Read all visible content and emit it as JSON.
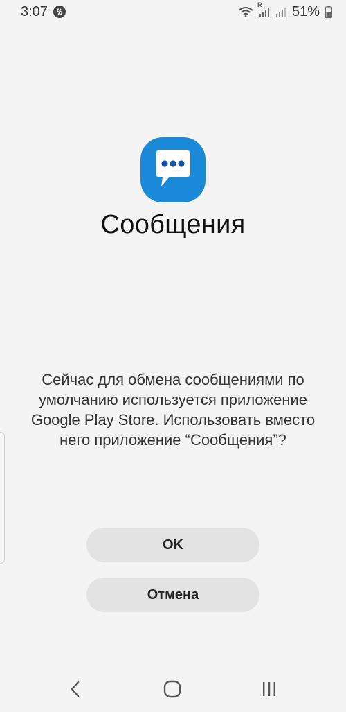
{
  "status_bar": {
    "time": "3:07",
    "battery_percent": "51%",
    "signal_label": "R"
  },
  "app": {
    "title": "Сообщения",
    "icon": "messages-bubble-icon",
    "accent_color": "#1a8ad8"
  },
  "dialog": {
    "message": "Сейчас для обмена сообщениями по умолчанию используется приложение Google Play Store. Использовать вместо него приложение “Сообщения”?",
    "ok_label": "OK",
    "cancel_label": "Отмена"
  },
  "nav_bar": {
    "back_icon": "back-chevron-icon",
    "home_icon": "home-icon",
    "recents_icon": "recents-icon"
  }
}
